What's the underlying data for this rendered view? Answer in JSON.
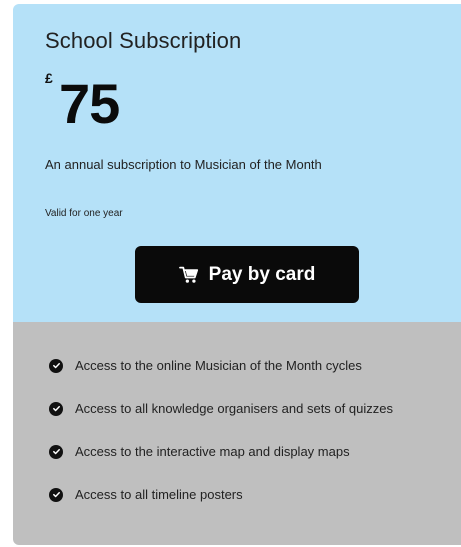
{
  "plan": {
    "title": "School Subscription",
    "currency_symbol": "£",
    "price": "75",
    "description": "An annual subscription to Musician of the Month",
    "validity": "Valid for one year",
    "pay_button_label": "Pay by card",
    "pay_button_icon": "cart-icon"
  },
  "features": [
    {
      "icon": "check-circle-icon",
      "text": "Access to the online Musician of the Month cycles"
    },
    {
      "icon": "check-circle-icon",
      "text": "Access to all knowledge organisers and sets of quizzes"
    },
    {
      "icon": "check-circle-icon",
      "text": "Access to the interactive map and display maps"
    },
    {
      "icon": "check-circle-icon",
      "text": "Access to all timeline posters"
    }
  ],
  "colors": {
    "header_background": "#b5e1f8",
    "features_background": "#bfbfbf",
    "button_background": "#0a0a0a",
    "button_text": "#ffffff"
  }
}
